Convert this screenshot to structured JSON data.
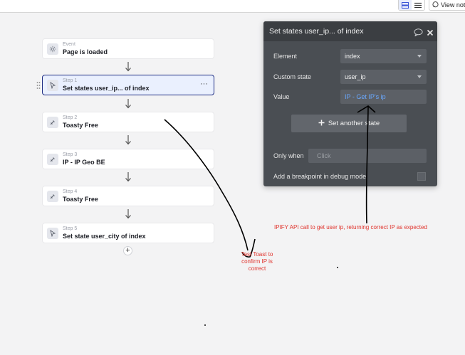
{
  "topbar": {
    "view_notes_label": "View not"
  },
  "workflow": {
    "steps": [
      {
        "kind": "Event",
        "name": "Page is loaded",
        "icon": "gear-icon"
      },
      {
        "kind": "Step 1",
        "name": "Set states user_ip... of index",
        "icon": "cursor-icon",
        "selected": true
      },
      {
        "kind": "Step 2",
        "name": "Toasty Free",
        "icon": "plugin-icon"
      },
      {
        "kind": "Step 3",
        "name": "IP - IP Geo BE",
        "icon": "plugin-icon"
      },
      {
        "kind": "Step 4",
        "name": "Toasty Free",
        "icon": "plugin-icon"
      },
      {
        "kind": "Step 5",
        "name": "Set state user_city of index",
        "icon": "cursor-icon"
      }
    ],
    "add_step_symbol": "+",
    "more_symbol": "···"
  },
  "panel": {
    "title": "Set states user_ip... of index",
    "element_label": "Element",
    "element_value": "index",
    "custom_state_label": "Custom state",
    "custom_state_value": "user_ip",
    "value_label": "Value",
    "value_expression": "IP - Get IP's ip",
    "set_another_label": "Set another state",
    "only_when_label": "Only when",
    "only_when_placeholder": "Click",
    "breakpoint_label": "Add a breakpoint in debug mode"
  },
  "annotations": {
    "ipify_note": "IPIFY API call to get user ip, returning correct IP as expected",
    "toast_note": "Test Toast to confirm IP is correct"
  },
  "colors": {
    "selected_border": "#1d2c82",
    "panel_bg": "#4a4e53",
    "expression_blue": "#6aa9ff",
    "annotation_red": "#e0322b"
  }
}
